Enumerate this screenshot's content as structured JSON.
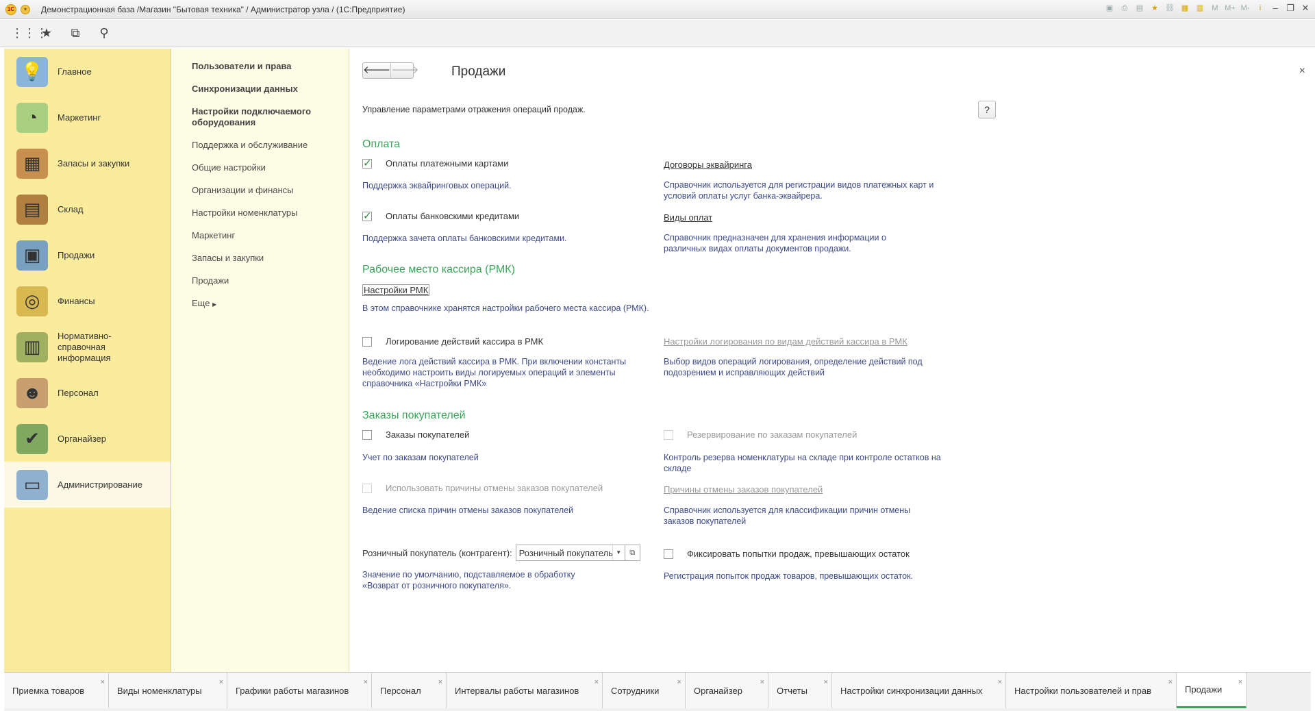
{
  "window": {
    "title": "Демонстрационная база /Магазин \"Бытовая техника\" / Администратор узла /  (1С:Предприятие)",
    "logo": "1С",
    "right_icons": [
      "M",
      "M+",
      "M-",
      "i"
    ]
  },
  "sections": [
    {
      "label": "Главное",
      "icon": "desk-lamp-icon",
      "color": "#8ab4d8"
    },
    {
      "label": "Маркетинг",
      "icon": "pie-chart-icon",
      "color": "#a8d080"
    },
    {
      "label": "Запасы и закупки",
      "icon": "boxes-icon",
      "color": "#c89050"
    },
    {
      "label": "Склад",
      "icon": "shelves-icon",
      "color": "#b08040"
    },
    {
      "label": "Продажи",
      "icon": "cash-register-icon",
      "color": "#7aa0c0"
    },
    {
      "label": "Финансы",
      "icon": "coins-icon",
      "color": "#d8b850"
    },
    {
      "label": "Нормативно-справочная информация",
      "icon": "binders-icon",
      "color": "#a0b060"
    },
    {
      "label": "Персонал",
      "icon": "person-icon",
      "color": "#c8a070"
    },
    {
      "label": "Органайзер",
      "icon": "clipboard-icon",
      "color": "#80a860"
    },
    {
      "label": "Администрирование",
      "icon": "computer-icon",
      "color": "#90b0d0"
    }
  ],
  "nav": [
    {
      "label": "Пользователи и права",
      "bold": true
    },
    {
      "label": "Синхронизации данных",
      "bold": true
    },
    {
      "label": "Настройки подключаемого оборудования",
      "bold": true
    },
    {
      "label": "Поддержка и обслуживание",
      "bold": false
    },
    {
      "label": "Общие настройки",
      "bold": false
    },
    {
      "label": "Организации и финансы",
      "bold": false
    },
    {
      "label": "Настройки номенклатуры",
      "bold": false
    },
    {
      "label": "Маркетинг",
      "bold": false
    },
    {
      "label": "Запасы и закупки",
      "bold": false
    },
    {
      "label": "Продажи",
      "bold": false
    },
    {
      "label": "Еще",
      "bold": false
    }
  ],
  "page": {
    "title": "Продажи",
    "back": "🡐",
    "forward": "🡒",
    "close": "×",
    "help": "?",
    "subtitle": "Управление параметрами отражения операций продаж."
  },
  "payment": {
    "title": "Оплата",
    "cards_label": "Оплаты платежными картами",
    "cards_checked": true,
    "cards_desc": "Поддержка эквайринговых операций.",
    "acq_link": "Договоры эквайринга",
    "acq_desc": "Справочник используется для регистрации видов платежных карт и условий оплаты услуг банка-эквайрера.",
    "credit_label": "Оплаты банковскими кредитами",
    "credit_checked": true,
    "credit_desc": "Поддержка зачета оплаты банковскими кредитами.",
    "types_link": "Виды оплат",
    "types_desc": "Справочник предназначен для хранения информации о различных видах оплаты документов продажи."
  },
  "rmk": {
    "title": "Рабочее место кассира (РМК)",
    "settings_link": "Настройки РМК",
    "settings_desc": "В этом справочнике хранятся настройки рабочего места кассира (РМК).",
    "log_label": "Логирование действий кассира в РМК",
    "log_checked": false,
    "log_desc": "Ведение лога действий кассира в РМК. При включении константы необходимо настроить виды логируемых операций и элементы справочника «Настройки РМК»",
    "log_link": "Настройки логирования по видам действий кассира в РМК",
    "log_link_desc": "Выбор видов операций логирования, определение действий под подозрением и исправляющих действий"
  },
  "orders": {
    "title": "Заказы покупателей",
    "orders_label": "Заказы покупателей",
    "orders_checked": false,
    "orders_desc": "Учет по заказам покупателей",
    "reserve_label": "Резервирование по заказам покупателей",
    "reserve_desc": "Контроль резерва номенклатуры на складе при контроле остатков на складе",
    "cancel_label": "Использовать причины отмены заказов покупателей",
    "cancel_desc": "Ведение списка причин отмены заказов покупателей",
    "cancel_link": "Причины отмены заказов покупателей",
    "cancel_link_desc": "Справочник используется для классификации причин отмены заказов покупателей",
    "retail_label": "Розничный покупатель (контрагент):",
    "retail_value": "Розничный покупатель",
    "retail_desc": "Значение по умолчанию, подставляемое в обработку «Возврат от розничного покупателя».",
    "fix_label": "Фиксировать попытки продаж, превышающих остаток",
    "fix_checked": false,
    "fix_desc": "Регистрация попыток продаж товаров, превышающих остаток."
  },
  "tabs": [
    {
      "label": "Приемка товаров",
      "active": false
    },
    {
      "label": "Виды номенклатуры",
      "active": false
    },
    {
      "label": "Графики работы магазинов",
      "active": false
    },
    {
      "label": "Персонал",
      "active": false
    },
    {
      "label": "Интервалы работы магазинов",
      "active": false
    },
    {
      "label": "Сотрудники",
      "active": false
    },
    {
      "label": "Органайзер",
      "active": false
    },
    {
      "label": "Отчеты",
      "active": false
    },
    {
      "label": "Настройки синхронизации данных",
      "active": false
    },
    {
      "label": "Настройки пользователей и прав",
      "active": false
    },
    {
      "label": "Продажи",
      "active": true
    }
  ]
}
